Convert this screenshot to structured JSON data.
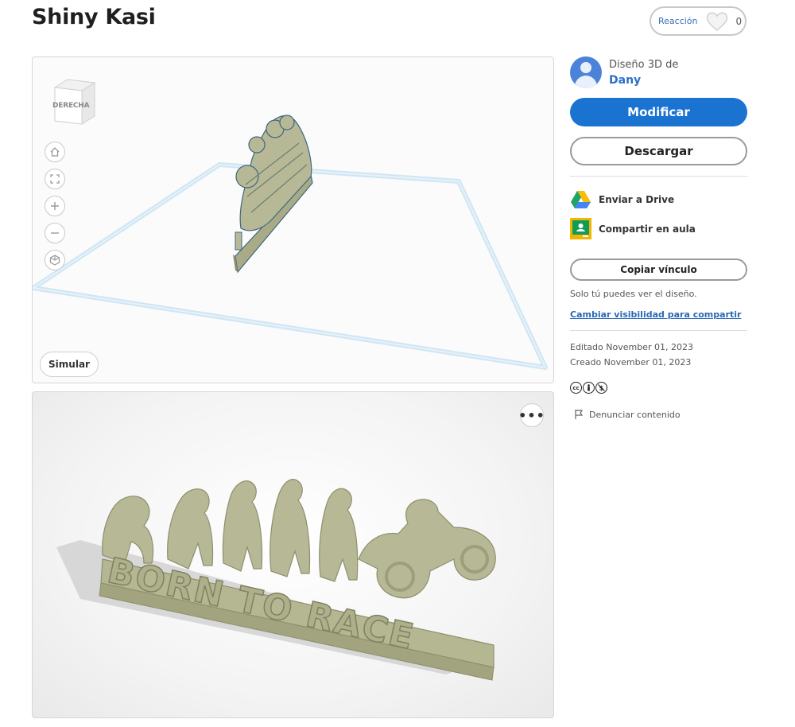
{
  "design": {
    "title": "Shiny Kasi"
  },
  "reaction": {
    "label": "Reacción",
    "count": "0"
  },
  "viewer": {
    "navcube_label": "DERECHA",
    "tools": [
      "home-icon",
      "fit-view-icon",
      "zoom-in-icon",
      "zoom-out-icon",
      "perspective-icon"
    ],
    "simulate_label": "Simular"
  },
  "render": {
    "more_label": "•••",
    "model_text": "BORN TO RACE"
  },
  "author": {
    "prefix": "Diseño 3D de",
    "name": "Dany"
  },
  "actions": {
    "modify_label": "Modificar",
    "download_label": "Descargar",
    "drive_label": "Enviar a Drive",
    "classroom_label": "Compartir en aula",
    "copy_link_label": "Copiar vínculo",
    "visibility_note": "Solo tú puedes ver el diseño.",
    "visibility_link": "Cambiar visibilidad para compartir"
  },
  "meta": {
    "edited": "Editado November 01, 2023",
    "created": "Creado November 01, 2023",
    "license_icons": [
      "cc",
      "by",
      "nc"
    ],
    "report_label": "Denunciar contenido"
  },
  "colors": {
    "primary": "#1a72d1",
    "model": "#b7b996",
    "workplane": "#cfe6f3"
  }
}
